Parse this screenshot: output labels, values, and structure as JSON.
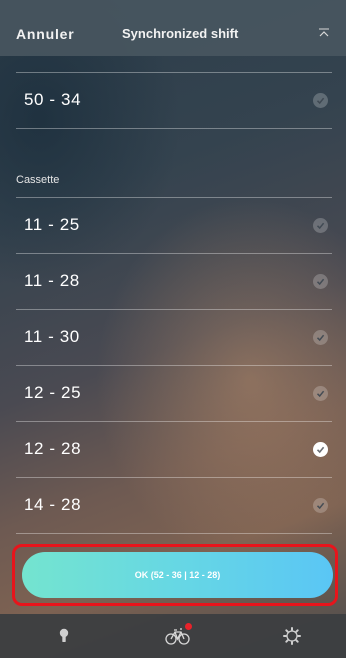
{
  "header": {
    "cancel_label": "Annuler",
    "title": "Synchronized shift",
    "collapse_icon": "chevron-up-icon"
  },
  "chainring": {
    "items": [
      {
        "label": "50 - 34",
        "selected": false
      }
    ]
  },
  "cassette": {
    "section_label": "Cassette",
    "items": [
      {
        "label": "11 - 25",
        "selected": false
      },
      {
        "label": "11 - 28",
        "selected": false
      },
      {
        "label": "11 - 30",
        "selected": false
      },
      {
        "label": "12 - 25",
        "selected": false
      },
      {
        "label": "12 - 28",
        "selected": true
      },
      {
        "label": "14 - 28",
        "selected": false
      }
    ]
  },
  "ok_button": {
    "label": "OK (52 - 36 | 12 - 28)"
  },
  "tabbar": {
    "tabs": [
      {
        "icon": "lightbulb-icon"
      },
      {
        "icon": "bicycle-icon",
        "notification": true
      },
      {
        "icon": "gear-icon"
      }
    ]
  },
  "colors": {
    "highlight": "#e8141b",
    "button_gradient_start": "#74e4cf",
    "button_gradient_end": "#5ac6f5",
    "notification_dot": "#e8222a"
  }
}
